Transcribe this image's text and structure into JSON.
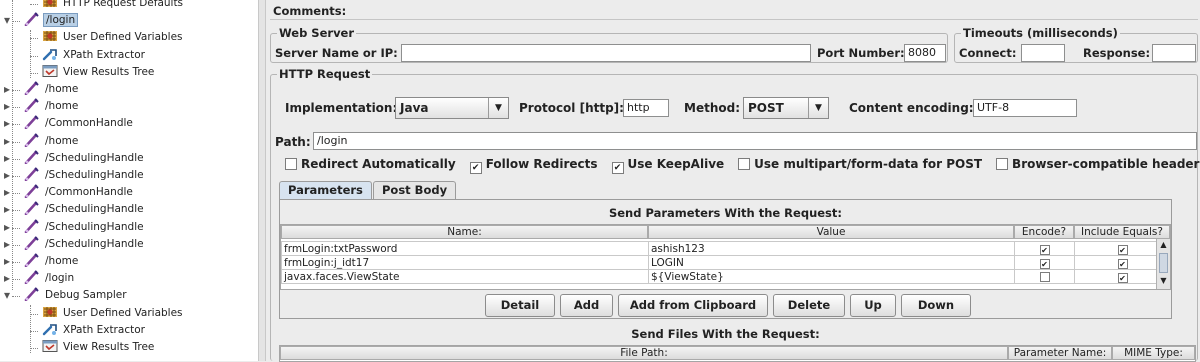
{
  "tree": [
    {
      "label": "HTTP Request Defaults",
      "icon": "config-icon",
      "depth": 1,
      "toggle": ""
    },
    {
      "label": "/login",
      "icon": "sampler-icon",
      "depth": 0,
      "toggle": "expanded",
      "selected": true
    },
    {
      "label": "User Defined Variables",
      "icon": "config-icon",
      "depth": 1,
      "toggle": ""
    },
    {
      "label": "XPath Extractor",
      "icon": "extractor-icon",
      "depth": 1,
      "toggle": ""
    },
    {
      "label": "View Results Tree",
      "icon": "listener-icon",
      "depth": 1,
      "toggle": ""
    },
    {
      "label": "/home",
      "icon": "sampler-icon",
      "depth": 0,
      "toggle": "collapsed"
    },
    {
      "label": "/home",
      "icon": "sampler-icon",
      "depth": 0,
      "toggle": "collapsed"
    },
    {
      "label": "/CommonHandle",
      "icon": "sampler-icon",
      "depth": 0,
      "toggle": "collapsed"
    },
    {
      "label": "/home",
      "icon": "sampler-icon",
      "depth": 0,
      "toggle": "collapsed"
    },
    {
      "label": "/SchedulingHandle",
      "icon": "sampler-icon",
      "depth": 0,
      "toggle": "collapsed"
    },
    {
      "label": "/SchedulingHandle",
      "icon": "sampler-icon",
      "depth": 0,
      "toggle": "collapsed"
    },
    {
      "label": "/CommonHandle",
      "icon": "sampler-icon",
      "depth": 0,
      "toggle": "collapsed"
    },
    {
      "label": "/SchedulingHandle",
      "icon": "sampler-icon",
      "depth": 0,
      "toggle": "collapsed"
    },
    {
      "label": "/SchedulingHandle",
      "icon": "sampler-icon",
      "depth": 0,
      "toggle": "collapsed"
    },
    {
      "label": "/SchedulingHandle",
      "icon": "sampler-icon",
      "depth": 0,
      "toggle": "collapsed"
    },
    {
      "label": "/home",
      "icon": "sampler-icon",
      "depth": 0,
      "toggle": "collapsed"
    },
    {
      "label": "/login",
      "icon": "sampler-icon",
      "depth": 0,
      "toggle": "collapsed"
    },
    {
      "label": "Debug Sampler",
      "icon": "sampler-icon",
      "depth": 0,
      "toggle": "expanded"
    },
    {
      "label": "User Defined Variables",
      "icon": "config-icon",
      "depth": 1,
      "toggle": ""
    },
    {
      "label": "XPath Extractor",
      "icon": "extractor-icon",
      "depth": 1,
      "toggle": ""
    },
    {
      "label": "View Results Tree",
      "icon": "listener-icon",
      "depth": 1,
      "toggle": ""
    }
  ],
  "comments_label": "Comments:",
  "web_server": {
    "title": "Web Server",
    "server_label": "Server Name or IP:",
    "server_value": "",
    "port_label": "Port Number:",
    "port_value": "8080"
  },
  "timeouts": {
    "title": "Timeouts (milliseconds)",
    "connect_label": "Connect:",
    "connect_value": "",
    "response_label": "Response:",
    "response_value": ""
  },
  "http_request": {
    "title": "HTTP Request",
    "implementation_label": "Implementation:",
    "implementation_value": "Java",
    "protocol_label": "Protocol [http]:",
    "protocol_value": "http",
    "method_label": "Method:",
    "method_value": "POST",
    "encoding_label": "Content encoding:",
    "encoding_value": "UTF-8",
    "path_label": "Path:",
    "path_value": "/login"
  },
  "options": [
    {
      "label": "Redirect Automatically",
      "checked": false
    },
    {
      "label": "Follow Redirects",
      "checked": true
    },
    {
      "label": "Use KeepAlive",
      "checked": true
    },
    {
      "label": "Use multipart/form-data for POST",
      "checked": false
    },
    {
      "label": "Browser-compatible headers",
      "checked": false
    }
  ],
  "tabs": {
    "parameters": "Parameters",
    "post_body": "Post Body"
  },
  "params": {
    "title": "Send Parameters With the Request:",
    "columns": {
      "name": "Name:",
      "value": "Value",
      "encode": "Encode?",
      "include": "Include Equals?"
    },
    "rows": [
      {
        "name": "frmLogin:txtPassword",
        "value": "ashish123",
        "encode": true,
        "include": true
      },
      {
        "name": "frmLogin:j_idt17",
        "value": "LOGIN",
        "encode": true,
        "include": true
      },
      {
        "name": "javax.faces.ViewState",
        "value": "${ViewState}",
        "encode": false,
        "include": true
      }
    ]
  },
  "buttons": {
    "detail": "Detail",
    "add": "Add",
    "add_clipboard": "Add from Clipboard",
    "delete": "Delete",
    "up": "Up",
    "down": "Down"
  },
  "files": {
    "title": "Send Files With the Request:",
    "columns": {
      "path": "File Path:",
      "param": "Parameter Name:",
      "mime": "MIME Type:"
    }
  }
}
